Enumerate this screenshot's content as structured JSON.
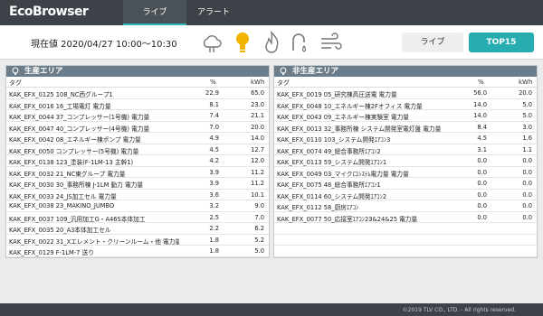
{
  "app": {
    "brand": "EcoBrowser"
  },
  "tabs": [
    {
      "label": "ライブ"
    },
    {
      "label": "アラート"
    }
  ],
  "header": {
    "current_label": "現在値 2020/04/27 10:00～10:30"
  },
  "buttons": {
    "live": "ライブ",
    "top15": "TOP15"
  },
  "icons": [
    "cloud-icon",
    "bulb-icon",
    "flame-icon",
    "faucet-icon",
    "wind-icon"
  ],
  "colors": {
    "accent": "#27adb0",
    "bulb": "#f2b400",
    "topbar": "#3c4247",
    "panel_title": "#6b7d8a"
  },
  "left_panel": {
    "title": "生産エリア",
    "col_tag": "タグ",
    "col_pct": "%",
    "col_kwh": "kWh",
    "rows": [
      {
        "tag": "KAK_EFX_0125 108_NC西グループ1",
        "pct": "22.9",
        "kwh": "65.0"
      },
      {
        "tag": "KAK_EFX_0016 16_工場電灯 電力量",
        "pct": "8.1",
        "kwh": "23.0"
      },
      {
        "tag": "KAK_EFX_0044 37_コンプレッサー(1号機) 電力量",
        "pct": "7.4",
        "kwh": "21.1"
      },
      {
        "tag": "KAK_EFX_0047 40_コンプレッサー(4号機) 電力量",
        "pct": "7.0",
        "kwh": "20.0"
      },
      {
        "tag": "KAK_EFX_0042 08_エネルギー棟ポンプ 電力量",
        "pct": "4.9",
        "kwh": "14.0"
      },
      {
        "tag": "KAK_EFX_0050 コンプレッサー(5号機) 電力量",
        "pct": "4.5",
        "kwh": "12.7"
      },
      {
        "tag": "KAK_EFX_0138 123_塗装(F-1LM-13 主幹1)",
        "pct": "4.2",
        "kwh": "12.0"
      },
      {
        "tag": "KAK_EFX_0032 21_NC東グループ 電力量",
        "pct": "3.9",
        "kwh": "11.2"
      },
      {
        "tag": "KAK_EFX_0030 30_事務所棟 J-1LM 動力 電力量",
        "pct": "3.9",
        "kwh": "11.2"
      },
      {
        "tag": "KAK_EFX_0033 24_JS加工セル 電力量",
        "pct": "3.6",
        "kwh": "10.1"
      },
      {
        "tag": "KAK_EFX_0038 23_MAKINO_JUMBO",
        "pct": "3.2",
        "kwh": "9.0"
      },
      {
        "tag": "KAK_EFX_0037 109_汎用加工G・A46S本体加工",
        "pct": "2.5",
        "kwh": "7.0"
      },
      {
        "tag": "KAK_EFX_0035 20_A3本体加工セル",
        "pct": "2.2",
        "kwh": "6.2"
      },
      {
        "tag": "KAK_EFX_0022 31_Xエレメント・クリーンルーム・他 電力量",
        "pct": "1.8",
        "kwh": "5.2"
      },
      {
        "tag": "KAK_EFX_0129 F-1LM-7 送り",
        "pct": "1.8",
        "kwh": "5.0"
      }
    ]
  },
  "right_panel": {
    "title": "非生産エリア",
    "col_tag": "タグ",
    "col_pct": "%",
    "col_kwh": "kWh",
    "rows": [
      {
        "tag": "KAK_EFX_0019 05_研究棟高圧送電 電力量",
        "pct": "56.0",
        "kwh": "20.0"
      },
      {
        "tag": "KAK_EFX_0048 10_エネルギー棟2Fオフィス 電力量",
        "pct": "14.0",
        "kwh": "5.0"
      },
      {
        "tag": "KAK_EFX_0043 09_エネルギー棟実験室 電力量",
        "pct": "14.0",
        "kwh": "5.0"
      },
      {
        "tag": "KAK_EFX_0013 32_事務所棟 システム開発室電灯盤 電力量",
        "pct": "8.4",
        "kwh": "3.0"
      },
      {
        "tag": "KAK_EFX_0110 103_システム開発ｴｱｺﾝ3",
        "pct": "4.5",
        "kwh": "1.6"
      },
      {
        "tag": "KAK_EFX_0074 49_総合事務所ｴｱｺﾝ2",
        "pct": "3.1",
        "kwh": "1.1"
      },
      {
        "tag": "KAK_EFX_0113 59_システム開発ｴｱｺﾝ1",
        "pct": "0.0",
        "kwh": "0.0"
      },
      {
        "tag": "KAK_EFX_0049 03_マイクロｼｽﾃﾑ電力量 電力量",
        "pct": "0.0",
        "kwh": "0.0"
      },
      {
        "tag": "KAK_EFX_0075 48_総合事務所ｴｱｺﾝ1",
        "pct": "0.0",
        "kwh": "0.0"
      },
      {
        "tag": "KAK_EFX_0114 60_システム開発ｴｱｺﾝ2",
        "pct": "0.0",
        "kwh": "0.0"
      },
      {
        "tag": "KAK_EFX_0112 58_厨房ｴｱｺﾝ",
        "pct": "0.0",
        "kwh": "0.0"
      },
      {
        "tag": "KAK_EFX_0077 50_応接室ｴｱｺﾝ23&24&25 電力量",
        "pct": "0.0",
        "kwh": "0.0"
      }
    ]
  },
  "footer": {
    "copyright": "©2019 TLV CO., LTD.   - All rights reserved."
  }
}
